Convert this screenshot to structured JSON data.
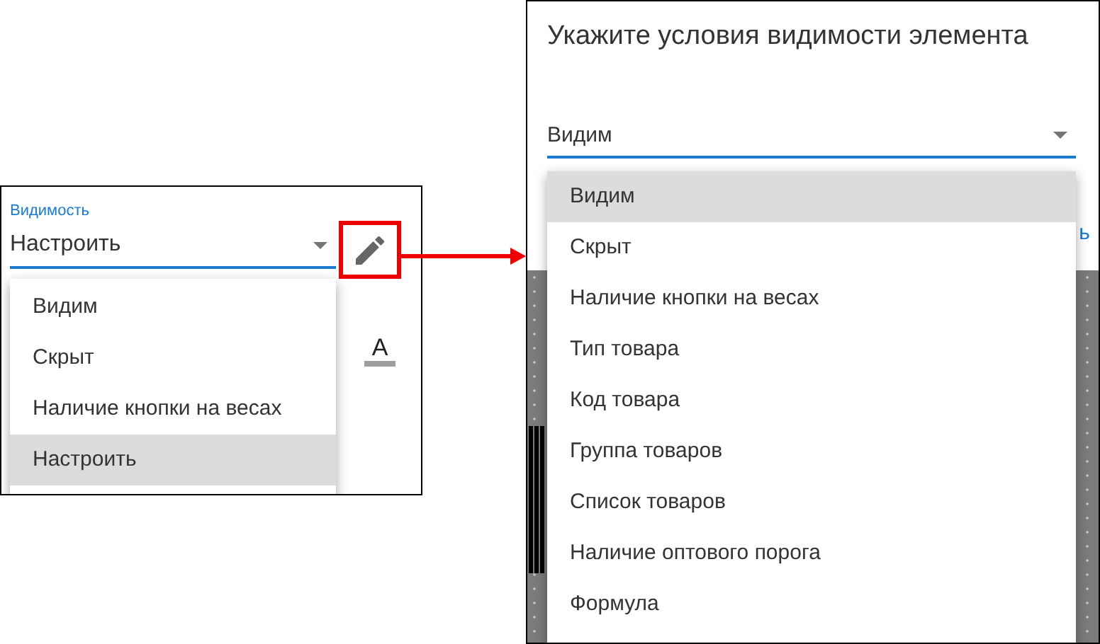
{
  "left_panel": {
    "field_label": "Видимость",
    "value": "Настроить",
    "text_color_glyph": "A",
    "menu": [
      {
        "label": "Видим",
        "selected": false
      },
      {
        "label": "Скрыт",
        "selected": false
      },
      {
        "label": "Наличие кнопки на весах",
        "selected": false
      },
      {
        "label": "Настроить",
        "selected": true
      }
    ]
  },
  "right_panel": {
    "title": "Укажите условия видимости элемента",
    "value": "Видим",
    "partial_link": "ь",
    "menu": [
      {
        "label": "Видим",
        "selected": true
      },
      {
        "label": "Скрыт",
        "selected": false
      },
      {
        "label": "Наличие кнопки на весах",
        "selected": false
      },
      {
        "label": "Тип товара",
        "selected": false
      },
      {
        "label": "Код товара",
        "selected": false
      },
      {
        "label": "Группа товаров",
        "selected": false
      },
      {
        "label": "Список товаров",
        "selected": false
      },
      {
        "label": "Наличие оптового порога",
        "selected": false
      },
      {
        "label": "Формула",
        "selected": false
      }
    ]
  }
}
